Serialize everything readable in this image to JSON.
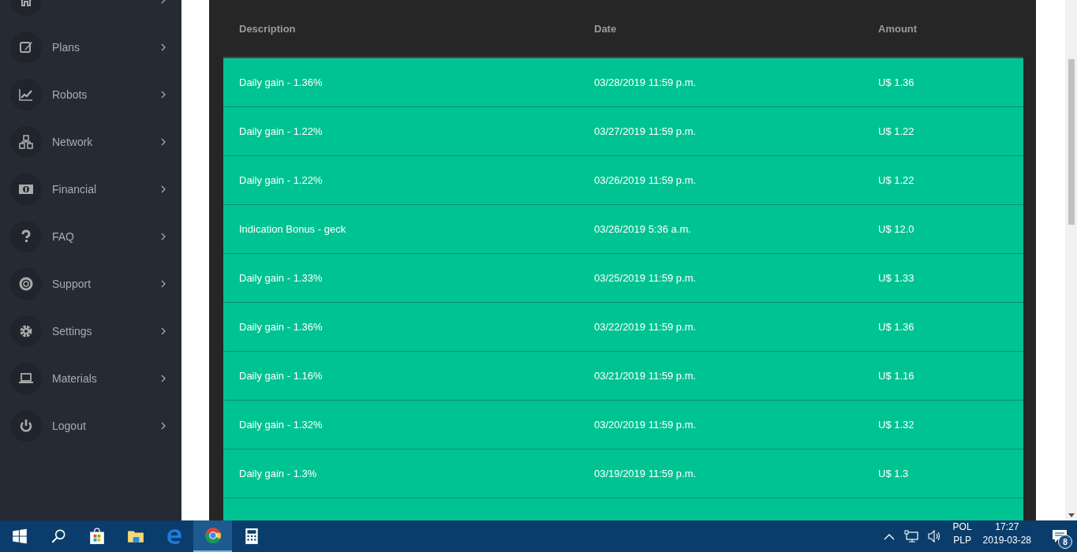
{
  "sidebar": {
    "items": [
      {
        "kind": "home"
      },
      {
        "label": "Plans",
        "kind": "edit"
      },
      {
        "label": "Robots",
        "kind": "chart"
      },
      {
        "label": "Network",
        "kind": "network"
      },
      {
        "label": "Financial",
        "kind": "money"
      },
      {
        "label": "FAQ",
        "kind": "question"
      },
      {
        "label": "Support",
        "kind": "lifebuoy"
      },
      {
        "label": "Settings",
        "kind": "gear"
      },
      {
        "label": "Materials",
        "kind": "laptop"
      },
      {
        "label": "Logout",
        "kind": "power"
      }
    ]
  },
  "table": {
    "columns": [
      "Description",
      "Date",
      "Amount"
    ],
    "rows": [
      {
        "description": "Daily gain - 1.36%",
        "date": "03/28/2019 11:59 p.m.",
        "amount": "U$ 1.36"
      },
      {
        "description": "Daily gain - 1.22%",
        "date": "03/27/2019 11:59 p.m.",
        "amount": "U$ 1.22"
      },
      {
        "description": "Daily gain - 1.22%",
        "date": "03/26/2019 11:59 p.m.",
        "amount": "U$ 1.22"
      },
      {
        "description": "Indication Bonus - geck",
        "date": "03/26/2019 5:36 a.m.",
        "amount": "U$ 12.0"
      },
      {
        "description": "Daily gain - 1.33%",
        "date": "03/25/2019 11:59 p.m.",
        "amount": "U$ 1.33"
      },
      {
        "description": "Daily gain - 1.36%",
        "date": "03/22/2019 11:59 p.m.",
        "amount": "U$ 1.36"
      },
      {
        "description": "Daily gain - 1.16%",
        "date": "03/21/2019 11:59 p.m.",
        "amount": "U$ 1.16"
      },
      {
        "description": "Daily gain - 1.32%",
        "date": "03/20/2019 11:59 p.m.",
        "amount": "U$ 1.32"
      },
      {
        "description": "Daily gain - 1.3%",
        "date": "03/19/2019 11:59 p.m.",
        "amount": "U$ 1.3"
      }
    ]
  },
  "taskbar": {
    "apps": [
      {
        "kind": "start",
        "selected": false
      },
      {
        "kind": "search",
        "selected": false
      },
      {
        "kind": "store",
        "selected": false
      },
      {
        "kind": "folder",
        "selected": false
      },
      {
        "kind": "edge",
        "selected": false
      },
      {
        "kind": "chrome",
        "selected": true
      },
      {
        "kind": "calculator",
        "selected": false
      }
    ],
    "language": "POL",
    "layout": "PLP",
    "time": "17:27",
    "date": "2019-03-28",
    "notification_count": "8"
  }
}
